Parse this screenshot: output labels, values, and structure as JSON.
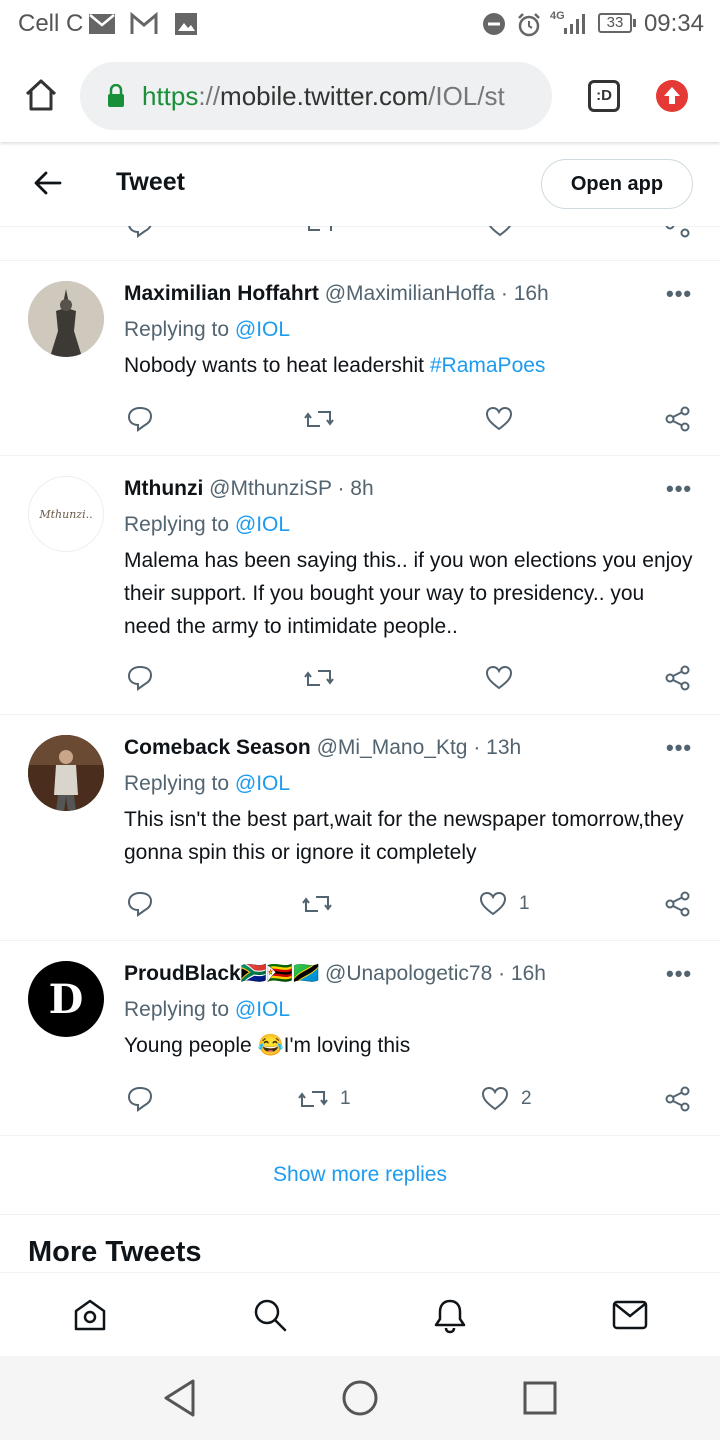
{
  "status_bar": {
    "carrier": "Cell C",
    "network": "4G",
    "battery": "33",
    "time": "09:34"
  },
  "browser": {
    "url_scheme": "https",
    "url_sep": "://",
    "url_host": "mobile.twitter.com",
    "url_path": "/IOL/st",
    "tab_switcher_label": ":D"
  },
  "header": {
    "title": "Tweet",
    "open_app": "Open app"
  },
  "replies": [
    {
      "display_name": "Maximilian Hoffahrt",
      "handle": "@MaximilianHoffa",
      "time": " · 16h",
      "replying_prefix": "Replying to ",
      "replying_to": "@IOL",
      "text": "Nobody wants to heat leadershit ",
      "hashtag": "#RamaPoes",
      "retweets": "",
      "likes": ""
    },
    {
      "display_name": "Mthunzi",
      "handle": "@MthunziSP",
      "time": " · 8h",
      "replying_prefix": "Replying to ",
      "replying_to": "@IOL",
      "text": "Malema has been saying this.. if you won elections you enjoy their support. If you bought your way to presidency.. you need the army to intimidate people..",
      "avatar_text": "Mthunzi..",
      "retweets": "",
      "likes": ""
    },
    {
      "display_name": "Comeback Season",
      "handle": "@Mi_Mano_Ktg",
      "time": " · 13h",
      "replying_prefix": "Replying to ",
      "replying_to": "@IOL",
      "text": "This isn't the best part,wait for the newspaper tomorrow,they gonna spin this or ignore it completely",
      "retweets": "",
      "likes": "1"
    },
    {
      "display_name": "ProudBlack",
      "display_name_flags": "🇿🇦🇿🇼🇹🇿",
      "handle": "@Unapologetic78",
      "time": " · 16h",
      "replying_prefix": "Replying to ",
      "replying_to": "@IOL",
      "text": "Young people 😂I'm loving this",
      "avatar_text": "D",
      "retweets": "1",
      "likes": "2"
    }
  ],
  "show_more": "Show more replies",
  "more_tweets": "More Tweets",
  "colors": {
    "accent": "#1d9bf0",
    "secondary_text": "#536471",
    "primary_text": "#0f1419",
    "divider": "#eff3f4"
  }
}
